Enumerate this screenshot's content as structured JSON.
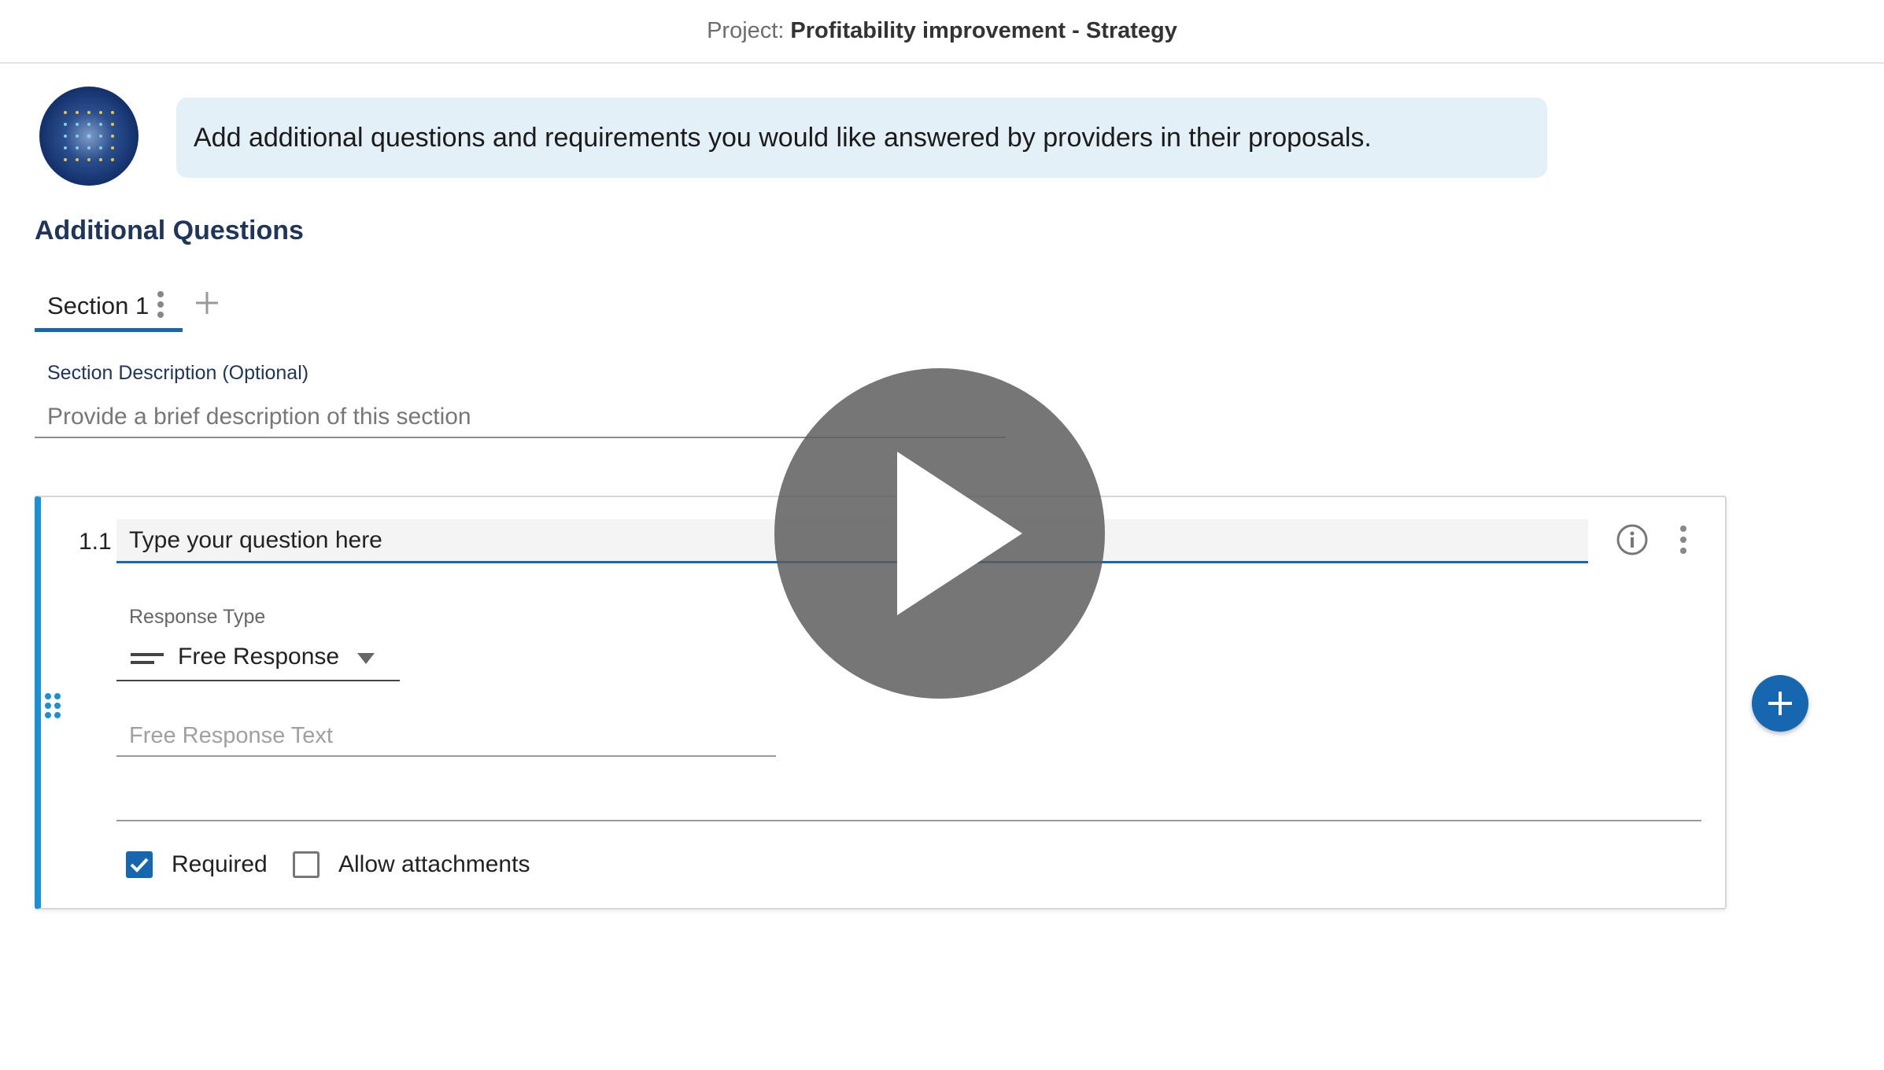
{
  "header": {
    "project_label": "Project:",
    "project_name": "Profitability improvement - Strategy"
  },
  "assistant": {
    "message": "Add additional questions and requirements you would like answered by providers in their proposals."
  },
  "page": {
    "title": "Additional Questions"
  },
  "tabs": [
    {
      "label": "Section 1",
      "active": true
    }
  ],
  "section": {
    "description_label": "Section Description (Optional)",
    "description_placeholder": "Provide a brief description of this section"
  },
  "question": {
    "number": "1.1",
    "placeholder": "Type your question here",
    "response_type_label": "Response Type",
    "response_type_value": "Free Response",
    "free_text_placeholder": "Free Response Text",
    "required_label": "Required",
    "required_checked": true,
    "attachments_label": "Allow attachments",
    "attachments_checked": false
  },
  "colors": {
    "accent": "#1767b0",
    "card_border_accent": "#1b8fd6",
    "title": "#1f3559",
    "bubble": "#e3f0f8"
  },
  "icons": [
    "kebab-icon",
    "plus-icon",
    "info-icon",
    "drag-handle-icon",
    "lines-icon",
    "caret-down-icon",
    "check-icon",
    "play-icon"
  ]
}
